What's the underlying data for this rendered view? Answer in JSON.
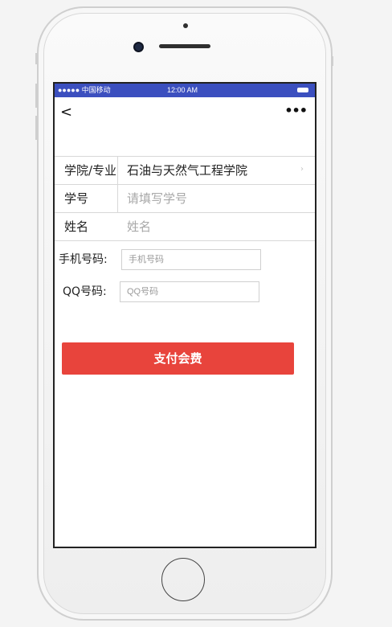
{
  "status_bar": {
    "carrier": "●●●●● 中国移动",
    "time": "12:00 AM"
  },
  "nav": {
    "back_glyph": "<",
    "more_glyph": "•••"
  },
  "form": {
    "college": {
      "label": "学院/专业",
      "value": "石油与天然气工程学院",
      "chevron": "›"
    },
    "student_id": {
      "label": "学号",
      "placeholder": "请填写学号"
    },
    "name": {
      "label": "姓名",
      "placeholder": "姓名"
    }
  },
  "phone_field": {
    "label": "手机号码:",
    "placeholder": "手机号码"
  },
  "qq_field": {
    "label": "QQ号码:",
    "placeholder": "QQ号码"
  },
  "pay_button": {
    "label": "支付会费",
    "color": "#e8443c"
  },
  "colors": {
    "status_bar": "#3b4fbf"
  }
}
